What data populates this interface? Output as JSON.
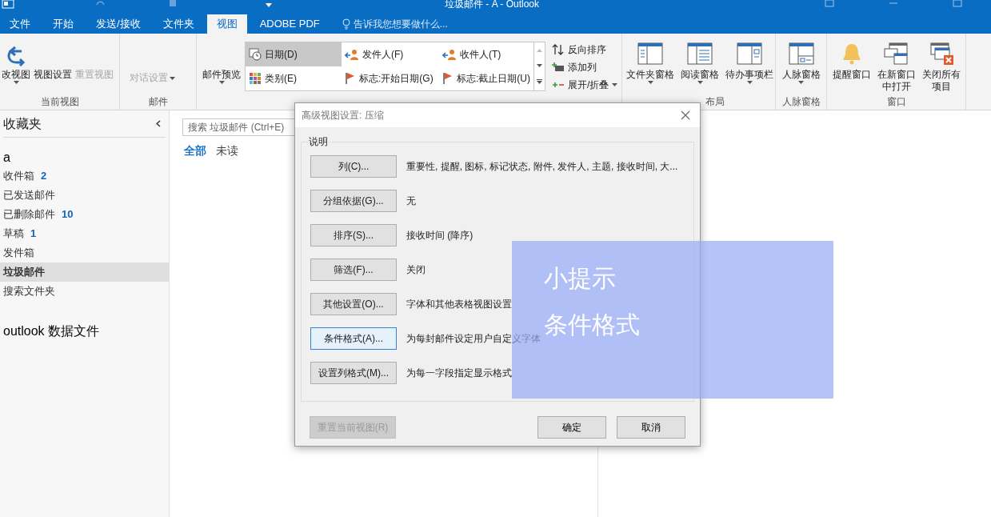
{
  "window": {
    "title": "垃圾邮件 - A - Outlook"
  },
  "ribbon_tabs": [
    {
      "label": "文件",
      "selected": false
    },
    {
      "label": "开始",
      "selected": false
    },
    {
      "label": "发送/接收",
      "selected": false
    },
    {
      "label": "文件夹",
      "selected": false
    },
    {
      "label": "视图",
      "selected": true
    },
    {
      "label": "ADOBE PDF",
      "selected": false
    }
  ],
  "tell_me": {
    "placeholder": "告诉我您想要做什么..."
  },
  "ribbon": {
    "current_view": {
      "label": "当前视图",
      "buttons": [
        {
          "label": "改视图",
          "disabled": false
        },
        {
          "label": "视图设置",
          "disabled": false
        },
        {
          "label": "重置视图",
          "disabled": true
        }
      ]
    },
    "mail": {
      "label": "邮件",
      "button": {
        "label": "对话设置",
        "disabled": true
      }
    },
    "arrangement": {
      "preview_button": "邮件预览",
      "gallery": [
        {
          "label": "日期(D)",
          "kind": "calendar",
          "selected": true
        },
        {
          "label": "发件人(F)",
          "kind": "person",
          "selected": false
        },
        {
          "label": "收件人(T)",
          "kind": "person",
          "selected": false
        },
        {
          "label": "类别(E)",
          "kind": "grid",
          "selected": false
        },
        {
          "label": "标志:开始日期(G)",
          "kind": "flag",
          "selected": false
        },
        {
          "label": "标志:截止日期(U)",
          "kind": "flag",
          "selected": false
        }
      ],
      "commands": [
        {
          "label": "反向排序",
          "kind": "sort",
          "dropdown": false
        },
        {
          "label": "添加列",
          "kind": "add",
          "dropdown": false
        },
        {
          "label": "展开/折叠",
          "kind": "expand",
          "dropdown": true
        }
      ]
    },
    "layout": {
      "label": "布局",
      "buttons": [
        {
          "label": "文件夹窗格",
          "kind": "folder"
        },
        {
          "label": "阅读窗格",
          "kind": "reading"
        },
        {
          "label": "待办事项栏",
          "kind": "todo"
        }
      ]
    },
    "people": {
      "label": "人脉窗格",
      "buttons": [
        {
          "label": "人脉窗格",
          "kind": "people"
        }
      ]
    },
    "window_group": {
      "label": "窗口",
      "buttons": [
        {
          "label": "提醒窗口",
          "kind": "bell"
        },
        {
          "label": "在新窗口中打开",
          "kind": "newwin"
        },
        {
          "label": "关闭所有项目",
          "kind": "closeall"
        }
      ]
    }
  },
  "nav": {
    "favorites": "收藏夹",
    "account": "a",
    "folders": [
      {
        "name": "收件箱",
        "count": "2",
        "selected": false
      },
      {
        "name": "已发送邮件",
        "selected": false
      },
      {
        "name": "已删除邮件",
        "count": "10",
        "selected": false
      },
      {
        "name": "草稿",
        "count": "1",
        "selected": false
      },
      {
        "name": "发件箱",
        "selected": false
      },
      {
        "name": "垃圾邮件",
        "selected": true
      },
      {
        "name": "搜索文件夹",
        "selected": false
      }
    ],
    "data_file": "outlook 数据文件"
  },
  "message_list": {
    "search": {
      "placeholder": "搜索 垃圾邮件 (Ctrl+E)"
    },
    "filters": [
      {
        "label": "全部",
        "selected": true
      },
      {
        "label": "未读",
        "selected": false
      }
    ]
  },
  "dialog": {
    "title": "高级视图设置: 压缩",
    "group": "说明",
    "rows": [
      {
        "button": "列(C)...",
        "description": "重要性, 提醒, 图标, 标记状态, 附件, 发件人, 主题, 接收时间, 大...",
        "focused": false
      },
      {
        "button": "分组依据(G)...",
        "description": "无",
        "focused": false
      },
      {
        "button": "排序(S)...",
        "description": "接收时间 (降序)",
        "focused": false
      },
      {
        "button": "筛选(F)...",
        "description": "关闭",
        "focused": false
      },
      {
        "button": "其他设置(O)...",
        "description": "字体和其他表格视图设置",
        "focused": false
      },
      {
        "button": "条件格式(A)...",
        "description": "为每封邮件设定用户自定义字体",
        "focused": true
      },
      {
        "button": "设置列格式(M)...",
        "description": "为每一字段指定显示格式",
        "focused": false
      }
    ],
    "reset_button": {
      "label": "重置当前视图(R)",
      "disabled": true
    },
    "ok_button": "确定",
    "cancel_button": "取消"
  },
  "tip_overlay": {
    "lines": [
      "小提示",
      "条件格式"
    ]
  }
}
